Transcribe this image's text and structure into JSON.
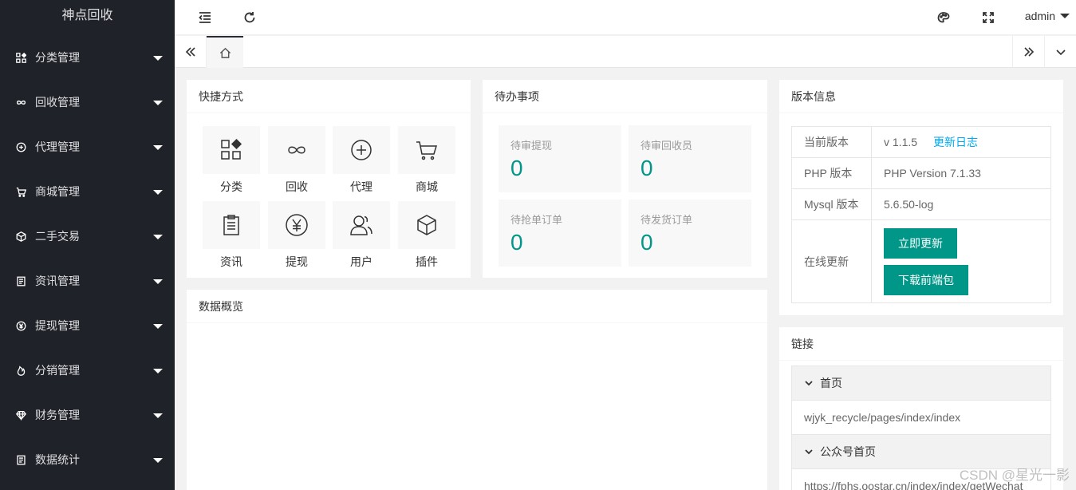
{
  "sidebar": {
    "logo": "神点回收",
    "items": [
      {
        "label": "分类管理",
        "icon": "grid-icon"
      },
      {
        "label": "回收管理",
        "icon": "infinity-icon"
      },
      {
        "label": "代理管理",
        "icon": "plus-circle-icon"
      },
      {
        "label": "商城管理",
        "icon": "cart-icon"
      },
      {
        "label": "二手交易",
        "icon": "cube-icon"
      },
      {
        "label": "资讯管理",
        "icon": "document-icon"
      },
      {
        "label": "提现管理",
        "icon": "yen-circle-icon"
      },
      {
        "label": "分销管理",
        "icon": "fire-icon"
      },
      {
        "label": "财务管理",
        "icon": "diamond-icon"
      },
      {
        "label": "数据统计",
        "icon": "document-icon"
      }
    ]
  },
  "header": {
    "user": "admin",
    "icons": [
      "menu-collapse-icon",
      "refresh-icon",
      "palette-icon",
      "fullscreen-icon"
    ]
  },
  "quick": {
    "title": "快捷方式",
    "items": [
      {
        "label": "分类",
        "icon": "grid-icon"
      },
      {
        "label": "回收",
        "icon": "infinity-icon"
      },
      {
        "label": "代理",
        "icon": "plus-circle-icon"
      },
      {
        "label": "商城",
        "icon": "cart-icon"
      },
      {
        "label": "资讯",
        "icon": "clipboard-icon"
      },
      {
        "label": "提现",
        "icon": "yen-circle-icon"
      },
      {
        "label": "用户",
        "icon": "users-icon"
      },
      {
        "label": "插件",
        "icon": "cube-icon"
      }
    ]
  },
  "todo": {
    "title": "待办事项",
    "items": [
      {
        "label": "待审提现",
        "count": "0"
      },
      {
        "label": "待审回收员",
        "count": "0"
      },
      {
        "label": "待抢单订单",
        "count": "0"
      },
      {
        "label": "待发货订单",
        "count": "0"
      }
    ]
  },
  "overview": {
    "title": "数据概览"
  },
  "version": {
    "title": "版本信息",
    "rows": [
      {
        "key": "当前版本",
        "value": "v 1.1.5",
        "link": "更新日志"
      },
      {
        "key": "PHP 版本",
        "value": "PHP Version 7.1.33"
      },
      {
        "key": "Mysql 版本",
        "value": "5.6.50-log"
      },
      {
        "key": "在线更新"
      }
    ],
    "update_button": "立即更新",
    "download_button": "下载前端包"
  },
  "links": {
    "title": "链接",
    "sections": [
      {
        "title": "首页",
        "value": "wjyk_recycle/pages/index/index"
      },
      {
        "title": "公众号首页",
        "value": "https://fphs.oostar.cn/index/index/getWechat"
      }
    ]
  },
  "watermark": "CSDN @星光一影",
  "colors": {
    "primary": "#009688",
    "sidebar": "#20222a",
    "link": "#01aaed"
  }
}
